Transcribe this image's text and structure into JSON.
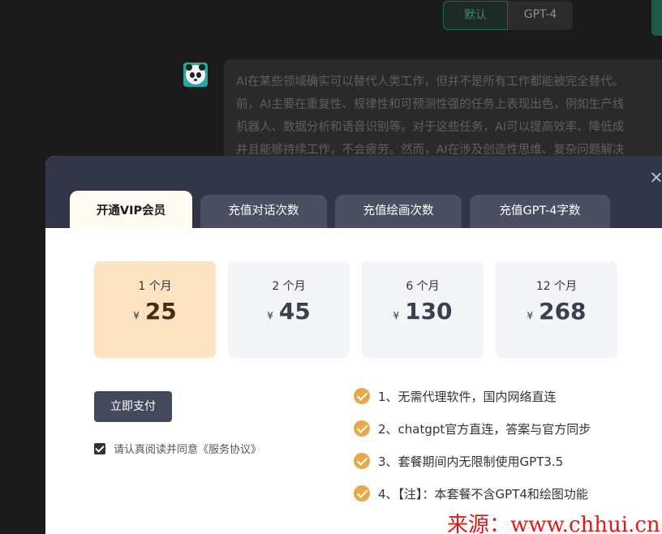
{
  "model_switch": {
    "default_label": "默认",
    "gpt4_label": "GPT-4"
  },
  "chat": {
    "ai_message_lines": [
      "AI在某些领域确实可以替代人类工作，但并不是所有工作都能被完全替代。",
      "前，AI主要在重复性、规律性和可预测性强的任务上表现出色，例如生产线",
      "机器人、数据分析和语音识别等。对于这些任务，AI可以提高效率、降低成",
      "并且能够持续工作，不会疲劳。然而，AI在涉及创造性思维、复杂问题解决"
    ]
  },
  "modal": {
    "tabs": [
      {
        "label": "开通VIP会员",
        "active": true
      },
      {
        "label": "充值对话次数",
        "active": false
      },
      {
        "label": "充值绘画次数",
        "active": false
      },
      {
        "label": "充值GPT-4字数",
        "active": false
      }
    ],
    "plans": [
      {
        "period": "1 个月",
        "currency": "¥",
        "price": "25",
        "selected": true
      },
      {
        "period": "2 个月",
        "currency": "¥",
        "price": "45",
        "selected": false
      },
      {
        "period": "6 个月",
        "currency": "¥",
        "price": "130",
        "selected": false
      },
      {
        "period": "12 个月",
        "currency": "¥",
        "price": "268",
        "selected": false
      }
    ],
    "pay_button_label": "立即支付",
    "agreement": {
      "checked": true,
      "text": "请认真阅读并同意《服务协议》"
    },
    "features": [
      "1、无需代理软件，国内网络直连",
      "2、chatgpt官方直连，答案与官方同步",
      "3、套餐期间内无限制使用GPT3.5",
      "4、【注】：本套餐不含GPT4和绘图功能"
    ]
  },
  "watermark": "来源：www.chhui.cn",
  "colors": {
    "accent_green": "#2f8f6d",
    "modal_header": "#313546",
    "selected_plan": "#fce3c1",
    "feature_check": "#e9a84a",
    "watermark": "#e31818"
  }
}
